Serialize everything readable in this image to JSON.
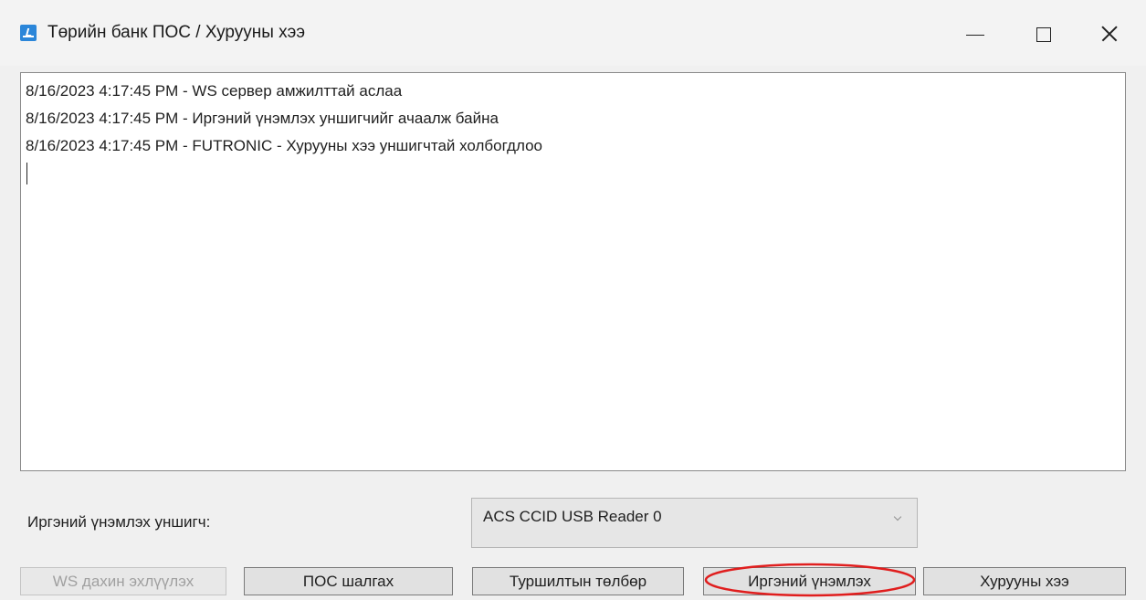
{
  "window": {
    "title": "Төрийн банк ПОС / Хурууны хээ",
    "controls": {
      "minimize": "minimize",
      "maximize": "maximize",
      "close": "close"
    }
  },
  "log": {
    "lines": [
      "8/16/2023 4:17:45 PM - WS сервер амжилттай аслаа",
      "8/16/2023 4:17:45 PM - Иргэний үнэмлэх уншигчийг ачаалж байна",
      "8/16/2023 4:17:45 PM - FUTRONIC - Хурууны хээ уншигчтай холбогдлоо"
    ]
  },
  "reader": {
    "label": "Иргэний үнэмлэх уншигч:",
    "selected": "ACS CCID USB Reader 0"
  },
  "buttons": {
    "ws_restart": "WS дахин эхлүүлэх",
    "pos_check": "ПОС шалгах",
    "test_payment": "Туршилтын төлбөр",
    "id_card": "Иргэний үнэмлэх",
    "fingerprint": "Хурууны хээ"
  },
  "annotation": {
    "highlight_color": "#e01e1e"
  }
}
